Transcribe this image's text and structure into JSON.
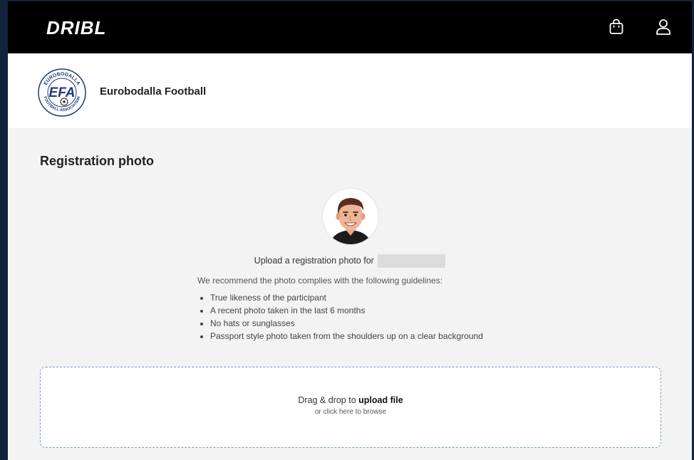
{
  "brand": {
    "name": "DRIBL"
  },
  "org": {
    "name": "Eurobodalla Football",
    "logo_letters": "EFA",
    "logo_ring_top": "EUROBODALLA",
    "logo_ring_bottom": "FOOTBALL ASSOCIATION"
  },
  "section": {
    "title": "Registration photo",
    "upload_prompt": "Upload a registration photo for",
    "guidelines_intro": "We recommend the photo complies with the following guidelines:",
    "guidelines": [
      "True likeness of the participant",
      "A recent photo taken in the last 6 months",
      "No hats or sunglasses",
      "Passport style photo taken from the shoulders up on a clear background"
    ]
  },
  "dropzone": {
    "text_prefix": "Drag & drop to",
    "text_bold": "upload file",
    "subtext": "or click here to browse"
  },
  "icons": {
    "cart": "shopping-bag-icon",
    "user": "user-icon"
  },
  "colors": {
    "topbar": "#000000",
    "page_bg": "#f3f3f3",
    "dropzone_border": "#7b9ac4"
  }
}
